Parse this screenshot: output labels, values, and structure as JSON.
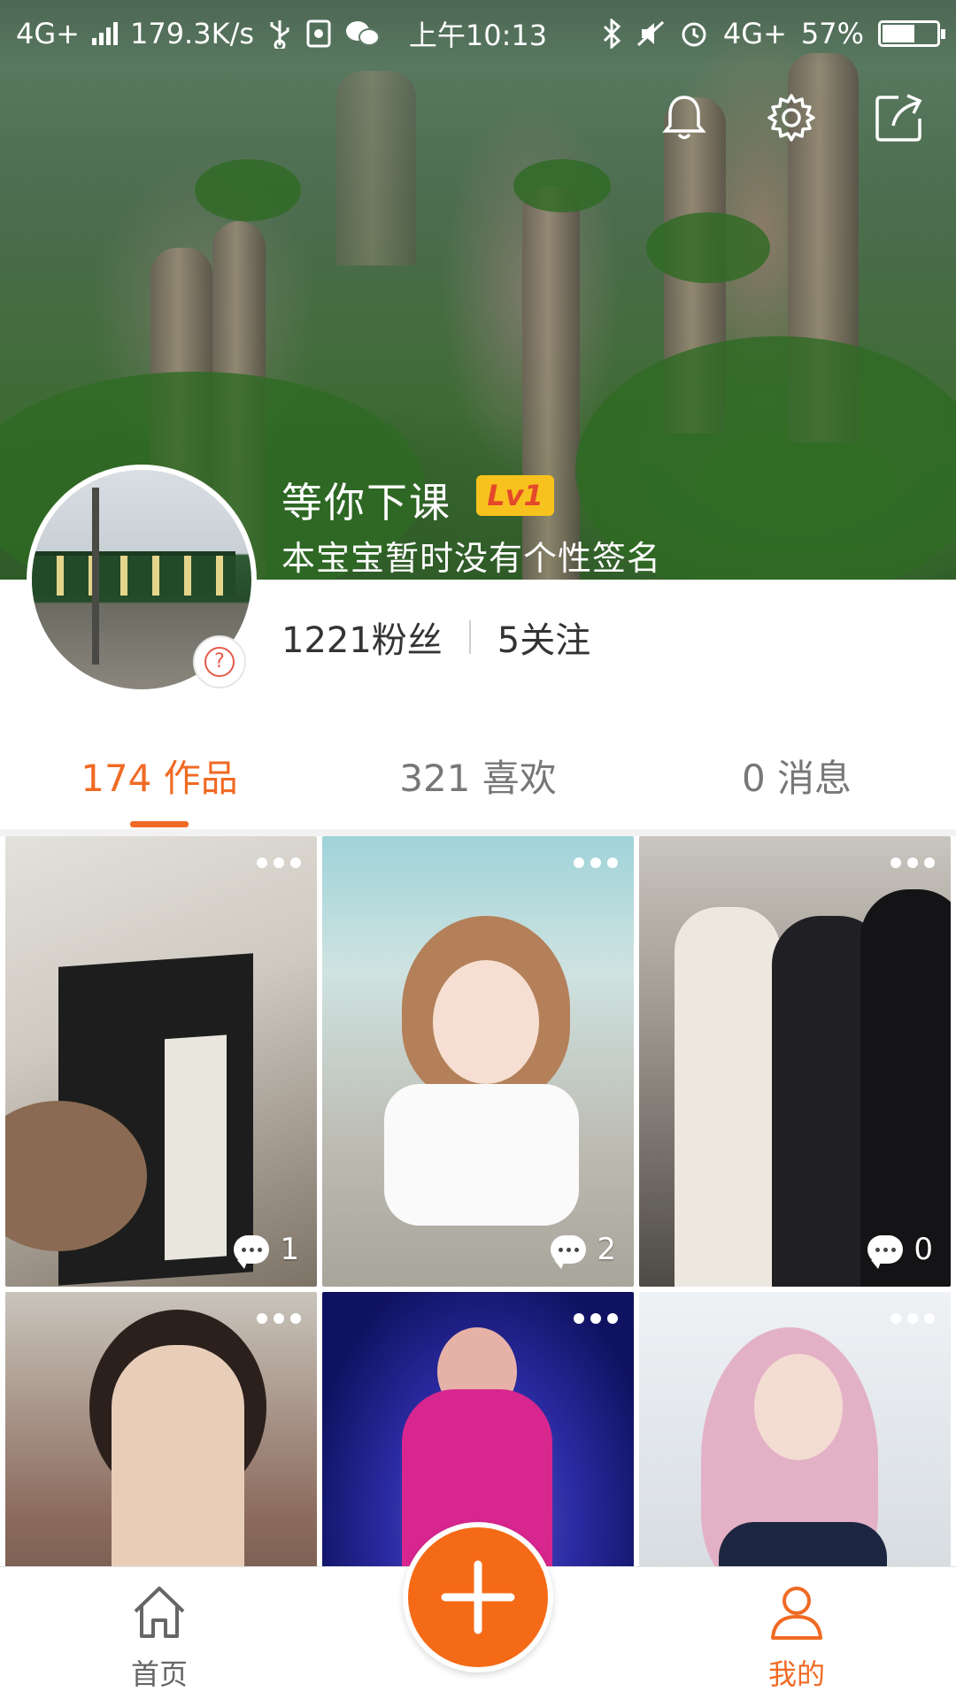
{
  "status_bar": {
    "network_left": "4G+",
    "speed": "179.3K/s",
    "time": "上午10:13",
    "network_right": "4G+",
    "battery": "57%",
    "battery_level": 0.57
  },
  "header": {
    "icons": [
      "bell-icon",
      "gear-icon",
      "share-icon"
    ]
  },
  "profile": {
    "name": "等你下课",
    "level": "Lv1",
    "bio": "本宝宝暂时没有个性签名",
    "fans": "1221粉丝",
    "following": "5关注"
  },
  "tabs": [
    {
      "label": "174 作品",
      "active": true
    },
    {
      "label": "321 喜欢",
      "active": false
    },
    {
      "label": "0 消息",
      "active": false
    }
  ],
  "grid": {
    "items": [
      {
        "comments": "1",
        "theme": "sketch"
      },
      {
        "comments": "2",
        "theme": "cosplay"
      },
      {
        "comments": "0",
        "theme": "crowd"
      },
      {
        "comments": "",
        "theme": "street"
      },
      {
        "comments": "",
        "theme": "stage"
      },
      {
        "comments": "",
        "theme": "portrait"
      }
    ]
  },
  "bottom_nav": {
    "home_label": "首页",
    "me_label": "我的",
    "active": "me"
  },
  "colors": {
    "accent": "#f06a24",
    "fab": "#f56a16",
    "level_badge": "#f7c21d",
    "level_text": "#e4492b"
  }
}
